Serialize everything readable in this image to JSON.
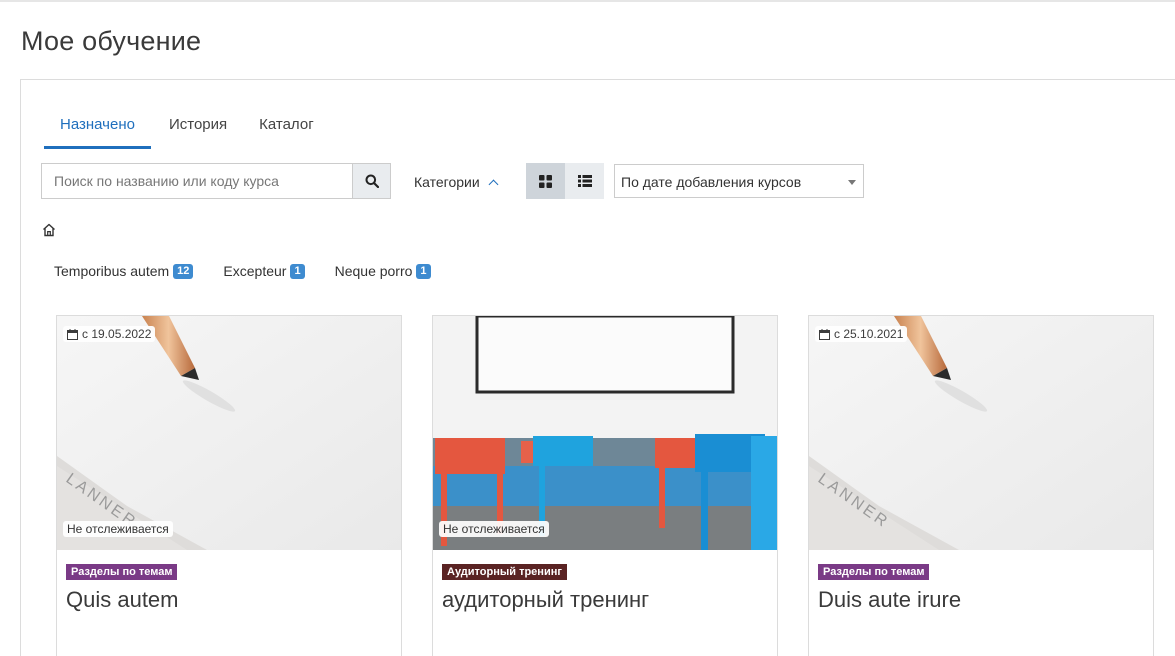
{
  "page": {
    "title": "Мое обучение"
  },
  "tabs": [
    {
      "label": "Назначено",
      "active": true
    },
    {
      "label": "История",
      "active": false
    },
    {
      "label": "Каталог",
      "active": false
    }
  ],
  "toolbar": {
    "search_placeholder": "Поиск по названию или коду курса",
    "search_value": "",
    "categories_label": "Категории",
    "sort_selected": "По дате добавления курсов"
  },
  "category_chips": [
    {
      "label": "Temporibus autem",
      "count": "12"
    },
    {
      "label": "Excepteur",
      "count": "1"
    },
    {
      "label": "Neque porro",
      "count": "1"
    }
  ],
  "cards": [
    {
      "date": "с 19.05.2022",
      "status": "Не отслеживается",
      "format": "Разделы по темам",
      "format_color": "#7a3a86",
      "title": "Quis autem",
      "image": "pen-planner"
    },
    {
      "date": "",
      "status": "Не отслеживается",
      "format": "Аудиторный тренинг",
      "format_color": "#5a2323",
      "title": "аудиторный тренинг",
      "image": "classroom-chairs"
    },
    {
      "date": "с 25.10.2021",
      "status": "",
      "format": "Разделы по темам",
      "format_color": "#7a3a86",
      "title": "Duis aute irure",
      "image": "pen-planner"
    }
  ],
  "icons": {
    "search": "search-icon",
    "grid": "grid-view-icon",
    "list": "list-view-icon",
    "home": "home-icon",
    "calendar": "calendar-icon"
  },
  "colors": {
    "accent": "#1f6fbd",
    "badge": "#3e8bd0"
  }
}
